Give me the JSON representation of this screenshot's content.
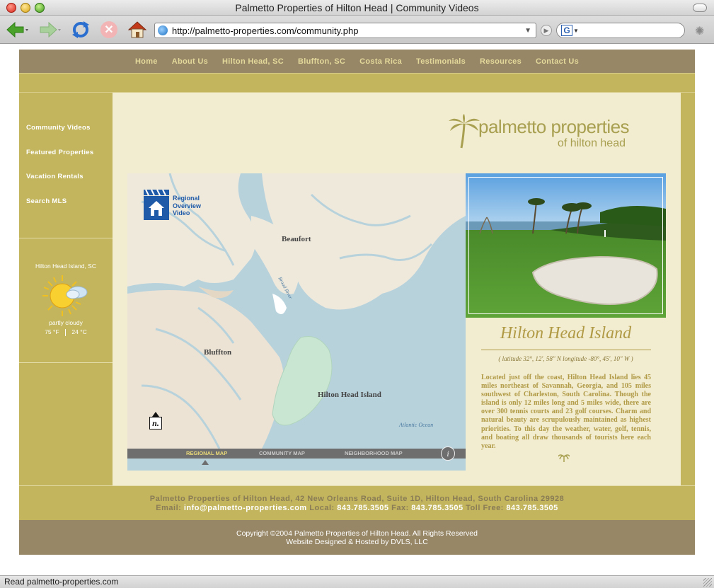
{
  "window": {
    "title": "Palmetto Properties of Hilton Head | Community Videos",
    "url": "http://palmetto-properties.com/community.php",
    "search_engine_glyph": "G",
    "status": "Read palmetto-properties.com"
  },
  "topnav": {
    "items": [
      "Home",
      "About Us",
      "Hilton Head, SC",
      "Bluffton, SC",
      "Costa Rica",
      "Testimonials",
      "Resources",
      "Contact Us"
    ]
  },
  "sidebar": {
    "items": [
      "Community Videos",
      "Featured Properties",
      "Vacation Rentals",
      "Search MLS"
    ]
  },
  "weather": {
    "location": "Hilton Head Island, SC",
    "condition": "partly cloudy",
    "temp_f": "75",
    "unit_f": "°F",
    "temp_c": "24",
    "unit_c": "°C",
    "icon": "partly-cloudy-icon"
  },
  "logo": {
    "main": "palmetto properties",
    "sub": "of hilton head"
  },
  "map": {
    "video_label": [
      "Regional",
      "Overview",
      "Video"
    ],
    "labels": {
      "beaufort": "Beaufort",
      "bluffton": "Bluffton",
      "hilton_head": "Hilton Head Island",
      "ocean": "Atlantic Ocean",
      "river": "Broad River"
    },
    "north_glyph": "n.",
    "tabs": [
      "REGIONAL MAP",
      "COMMUNITY MAP",
      "NEIGHBORHOOD MAP"
    ],
    "active_tab": "REGIONAL MAP",
    "info_glyph": "i"
  },
  "island": {
    "title": "Hilton Head Island",
    "coords": "( latitude 32°, 12', 58\" N   longitude -80°, 45', 10\" W )",
    "description": "Located just off the coast, Hilton Head Island lies 45 miles northeast of Savannah, Georgia, and 105 miles southwest of Charleston, South Carolina. Though the island is only 12 miles long and 5 miles wide, there are over 300 tennis courts and 23 golf courses. Charm and natural beauty are scrupulously maintained as highest priorities. To this day the weather, water, golf, tennis, and boating all draw thousands of tourists here each year."
  },
  "footer": {
    "address": "Palmetto Properties of Hilton Head, 42 New Orleans Road, Suite 1D, Hilton Head, South Carolina 29928",
    "email_label": "Email:",
    "email": "info@palmetto-properties.com",
    "local_label": "Local:",
    "local": "843.785.3505",
    "fax_label": "Fax:",
    "fax": "843.785.3505",
    "tollfree_label": "Toll Free:",
    "tollfree": "843.785.3505",
    "copyright": "Copyright ©2004 Palmetto Properties of Hilton Head. All Rights Reserved",
    "credit": "Website Designed & Hosted by DVLS, LLC"
  },
  "colors": {
    "nav_bg": "#978767",
    "olive": "#c2b55e",
    "cream": "#f2ecd0",
    "gold_text": "#b09a45",
    "water": "#b8d2dc"
  }
}
